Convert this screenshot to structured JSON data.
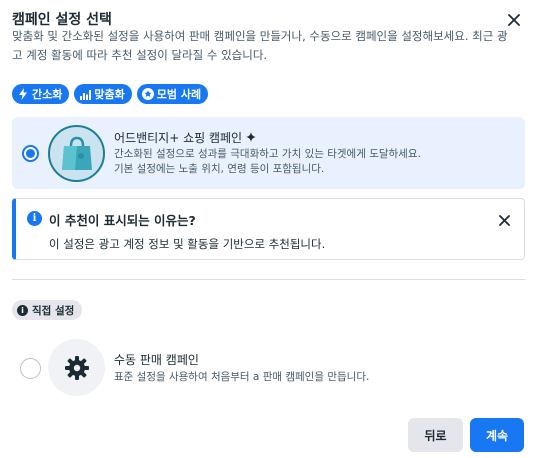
{
  "dialog": {
    "title": "캠페인 설정 선택",
    "description": "맞춤화 및 간소화된 설정을 사용하여 판매 캠페인을 만들거나, 수동으로 캠페인을 설정해보세요. 최근 광고 계정 활동에 따라 추천 설정이 달라질 수 있습니다.",
    "close_icon": "close-icon"
  },
  "chips": [
    {
      "label": "간소화",
      "icon": "lightning-icon"
    },
    {
      "label": "맞춤화",
      "icon": "bar-chart-icon"
    },
    {
      "label": "모범 사례",
      "icon": "star-icon"
    }
  ],
  "recommended_option": {
    "title": "어드밴티지+ 쇼핑 캠페인",
    "sparkle_icon": "sparkle-icon",
    "line1": "간소화된 설정으로 성과를 극대화하고 가치 있는 타겟에게 도달하세요.",
    "line2": "기본 설정에는 노출 위치, 연령 등이 포함됩니다.",
    "selected": true,
    "thumbnail_icon": "shopping-bag-icon"
  },
  "info_box": {
    "icon": "info-icon",
    "title": "이 추천이 표시되는 이유는?",
    "body": "이 설정은 광고 계정 정보 및 활동을 기반으로 추천됩니다."
  },
  "manual_section": {
    "chip_label": "직접 설정",
    "option": {
      "title": "수동 판매 캠페인",
      "subtitle": "표준 설정을 사용하여 처음부터 a 판매 캠페인을 만듭니다.",
      "selected": false,
      "thumbnail_icon": "gear-icon"
    }
  },
  "footer": {
    "back_label": "뒤로",
    "continue_label": "계속"
  },
  "colors": {
    "accent": "#1877f2",
    "selected_bg": "#e8f1fd",
    "text": "#1c2b33",
    "muted": "#465a69"
  }
}
